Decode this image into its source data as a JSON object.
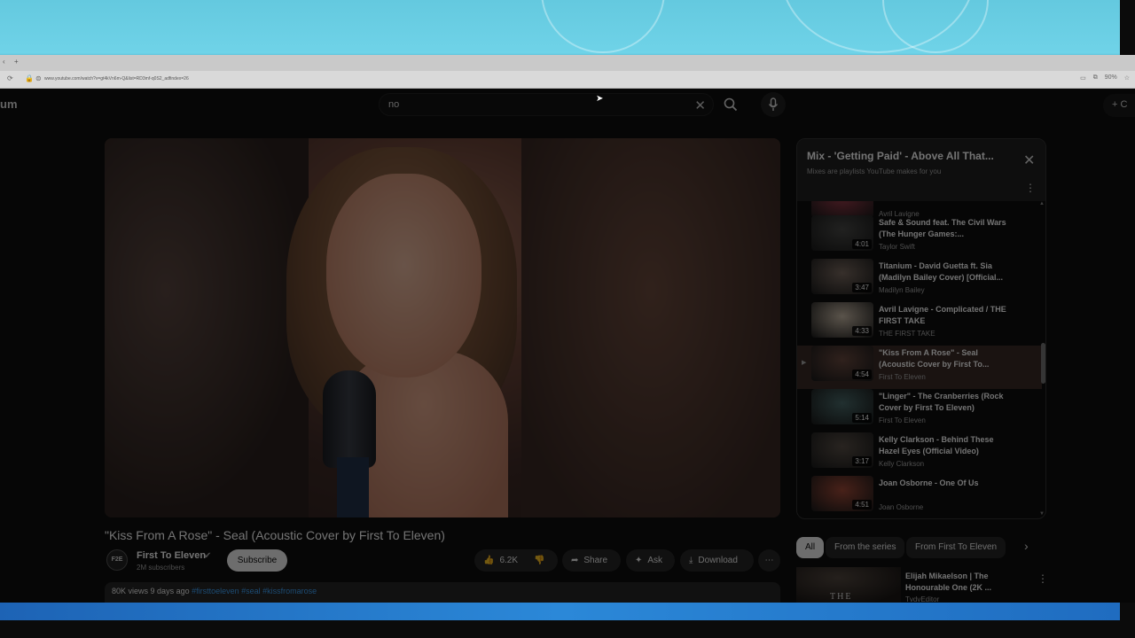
{
  "browser": {
    "url": "www.youtube.com/watch?v=gt4kVn6m-Q&list=RD3mf-q0S2_adfindex=26",
    "zoom": "90%"
  },
  "header": {
    "logo_fragment": "um",
    "search_value": "no",
    "create_label": "+ C"
  },
  "video": {
    "title": "\"Kiss From A Rose\" - Seal (Acoustic Cover by First To Eleven)",
    "channel_avatar_text": "F2E",
    "channel": "First To Eleven",
    "subscribers": "2M subscribers",
    "subscribe_label": "Subscribe",
    "likes": "6.2K",
    "share_label": "Share",
    "ask_label": "Ask",
    "download_label": "Download",
    "views": "80K views",
    "age": "9 days ago",
    "tags": "#firsttoeleven #seal #kissfromarose"
  },
  "playlist": {
    "title": "Mix - 'Getting Paid' - Above All That...",
    "subtitle": "Mixes are playlists YouTube makes for you",
    "items": [
      {
        "title": "",
        "artist": "Avril Lavigne",
        "duration": "",
        "thumb": "#9a3b4a"
      },
      {
        "title": "Safe & Sound feat. The Civil Wars (The Hunger Games:...",
        "artist": "Taylor Swift",
        "duration": "4:01",
        "thumb": "#4a4a48"
      },
      {
        "title": "Titanium - David Guetta ft. Sia (Madilyn Bailey Cover) [Official...",
        "artist": "Madilyn Bailey",
        "duration": "3:47",
        "thumb": "#7a6a60"
      },
      {
        "title": "Avril Lavigne - Complicated / THE FIRST TAKE",
        "artist": "THE FIRST TAKE",
        "duration": "4:33",
        "thumb": "#c8b9a6"
      },
      {
        "title": "\"Kiss From A Rose\" - Seal (Acoustic Cover by First To...",
        "artist": "First To Eleven",
        "duration": "4:54",
        "thumb": "#6a4a40"
      },
      {
        "title": "\"Linger\" - The Cranberries (Rock Cover by First To Eleven)",
        "artist": "First To Eleven",
        "duration": "5:14",
        "thumb": "#4a6a6a"
      },
      {
        "title": "Kelly Clarkson - Behind These Hazel Eyes (Official Video)",
        "artist": "Kelly Clarkson",
        "duration": "3:17",
        "thumb": "#5a5048"
      },
      {
        "title": "Joan Osborne - One Of Us",
        "artist": "Joan Osborne",
        "duration": "4:51",
        "thumb": "#a04a38"
      }
    ]
  },
  "chips": [
    "All",
    "From the series",
    "From First To Eleven"
  ],
  "recommendation": {
    "title": "Elijah Mikaelson | The Honourable One (2K ...",
    "channel": "TvdvEditor",
    "thumb_text": "THE HONOURABLE"
  },
  "colors": {
    "accent_link": "#3ea6ff",
    "page_bg": "#0f0f0f",
    "taskbar": "#2b88d8",
    "wallpaper": "#6fd3e8"
  }
}
